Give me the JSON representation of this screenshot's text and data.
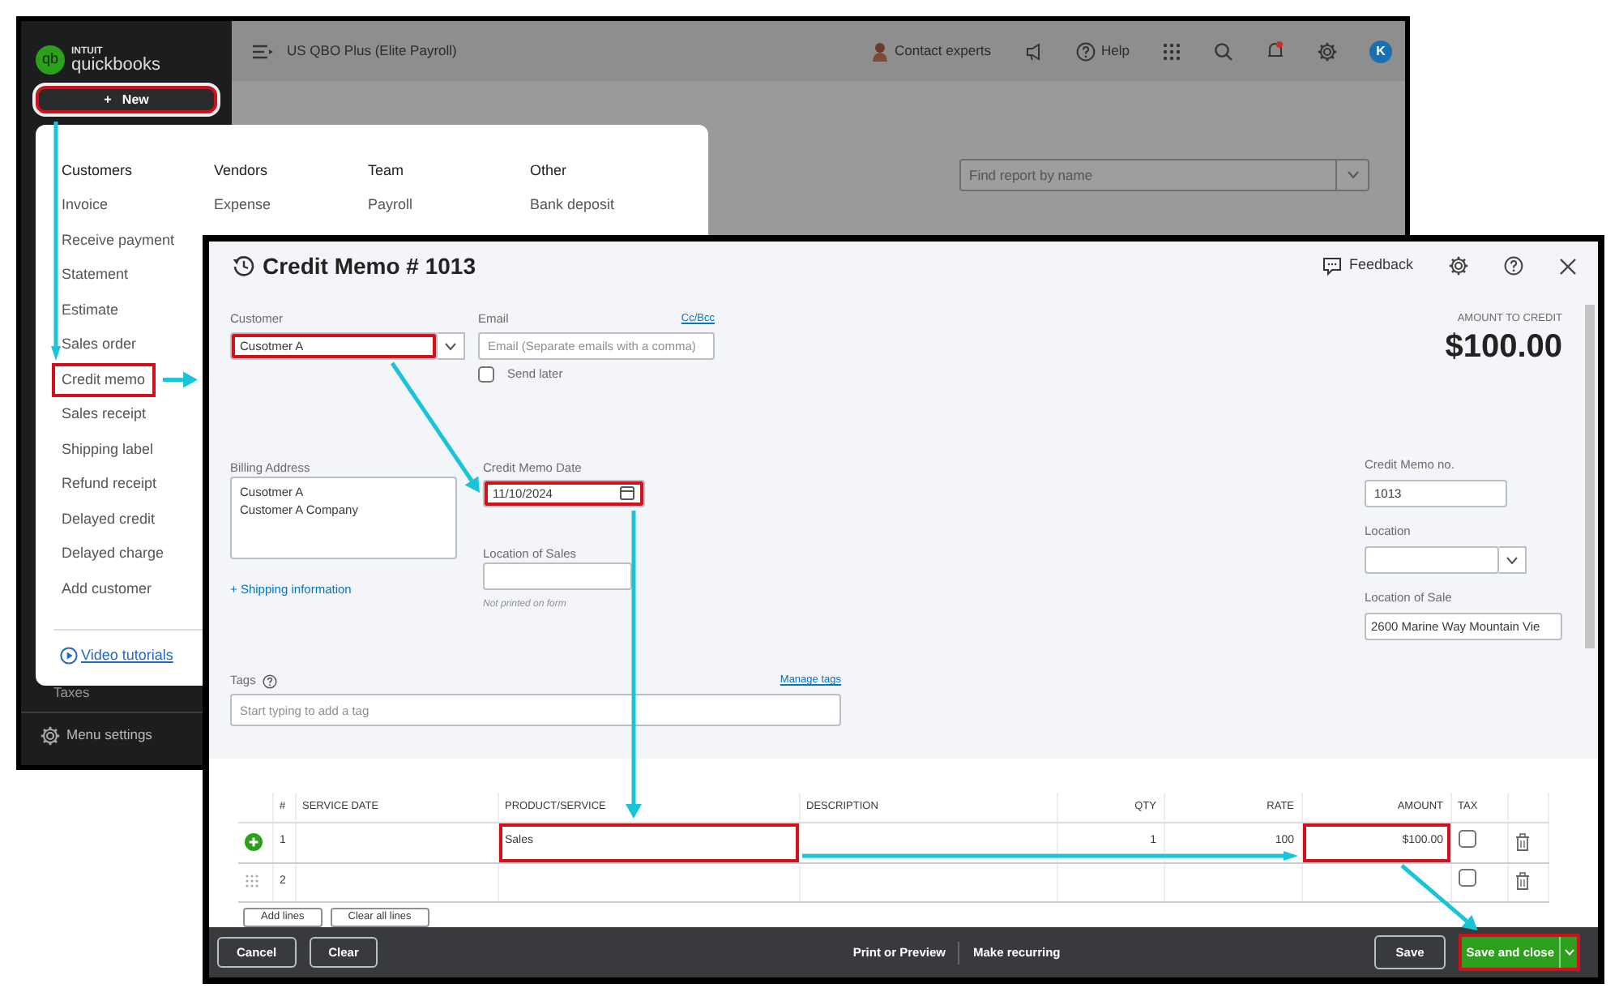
{
  "background_app": {
    "logo": {
      "mark": "qb",
      "maker": "INTUIT",
      "product": "quickbooks"
    },
    "new_button": {
      "icon": "+",
      "label": "New",
      "highlighted": true
    },
    "sidebar_items": [
      {
        "label": "Taxes",
        "kind": "plain"
      },
      {
        "label": "Menu settings",
        "kind": "settings"
      }
    ],
    "company": "US QBO Plus (Elite Payroll)",
    "toolbar": {
      "contact": "Contact experts",
      "help": "Help",
      "avatar": "K"
    },
    "report_search": {
      "placeholder": "Find report by name"
    }
  },
  "new_menu": {
    "columns": [
      {
        "heading": "Customers",
        "items": [
          {
            "label": "Invoice",
            "highlighted": false
          },
          {
            "label": "Receive payment",
            "highlighted": false
          },
          {
            "label": "Statement",
            "highlighted": false
          },
          {
            "label": "Estimate",
            "highlighted": false
          },
          {
            "label": "Sales order",
            "highlighted": false
          },
          {
            "label": "Credit memo",
            "highlighted": true
          },
          {
            "label": "Sales receipt",
            "highlighted": false
          },
          {
            "label": "Shipping label",
            "highlighted": false
          },
          {
            "label": "Refund receipt",
            "highlighted": false
          },
          {
            "label": "Delayed credit",
            "highlighted": false
          },
          {
            "label": "Delayed charge",
            "highlighted": false
          },
          {
            "label": "Add customer",
            "highlighted": false
          }
        ]
      },
      {
        "heading": "Vendors",
        "items": [
          {
            "label": "Expense",
            "highlighted": false
          }
        ]
      },
      {
        "heading": "Team",
        "items": [
          {
            "label": "Payroll",
            "highlighted": false
          }
        ]
      },
      {
        "heading": "Other",
        "items": [
          {
            "label": "Bank deposit",
            "highlighted": false
          }
        ]
      }
    ],
    "video_link": "Video tutorials"
  },
  "credit_memo": {
    "title": "Credit Memo # 1013",
    "feedback": "Feedback",
    "amount_label": "AMOUNT TO CREDIT",
    "amount": "$100.00",
    "customer": {
      "label": "Customer",
      "value": "Cusotmer A",
      "highlighted": true
    },
    "email": {
      "label": "Email",
      "link": "Cc/Bcc",
      "placeholder": "Email (Separate emails with a comma)"
    },
    "send_later": {
      "label": "Send later",
      "checked": false
    },
    "billing_address": {
      "label": "Billing Address",
      "lines": [
        "Cusotmer A",
        "Customer A Company"
      ]
    },
    "shipping_link": "+ Shipping information",
    "date": {
      "label": "Credit Memo Date",
      "value": "11/10/2024",
      "highlighted": true
    },
    "location_of_sales": {
      "label": "Location of Sales",
      "note": "Not printed on form"
    },
    "number": {
      "label": "Credit Memo no.",
      "value": "1013"
    },
    "location": {
      "label": "Location"
    },
    "location_of_sale": {
      "label": "Location of Sale",
      "value": "2600 Marine Way Mountain Vie"
    },
    "tags": {
      "label": "Tags",
      "link": "Manage tags",
      "placeholder": "Start typing to add a tag"
    },
    "table": {
      "columns": [
        "#",
        "SERVICE DATE",
        "PRODUCT/SERVICE",
        "DESCRIPTION",
        "QTY",
        "RATE",
        "AMOUNT",
        "TAX"
      ],
      "rows": [
        {
          "kind": "active",
          "number": "1",
          "product_service": "Sales",
          "qty": "1",
          "rate": "100",
          "amount": "$100.00",
          "tax": false,
          "product_highlighted": true,
          "amount_highlighted": true
        },
        {
          "kind": "blank",
          "number": "2",
          "tax": false,
          "product_highlighted": false,
          "amount_highlighted": false
        }
      ]
    },
    "line_buttons": [
      "Add lines",
      "Clear all lines"
    ],
    "footer": {
      "left": [
        "Cancel",
        "Clear"
      ],
      "center": [
        "Print or Preview",
        "Make recurring"
      ],
      "save": "Save",
      "save_close": {
        "label": "Save and close",
        "highlighted": true
      }
    }
  }
}
